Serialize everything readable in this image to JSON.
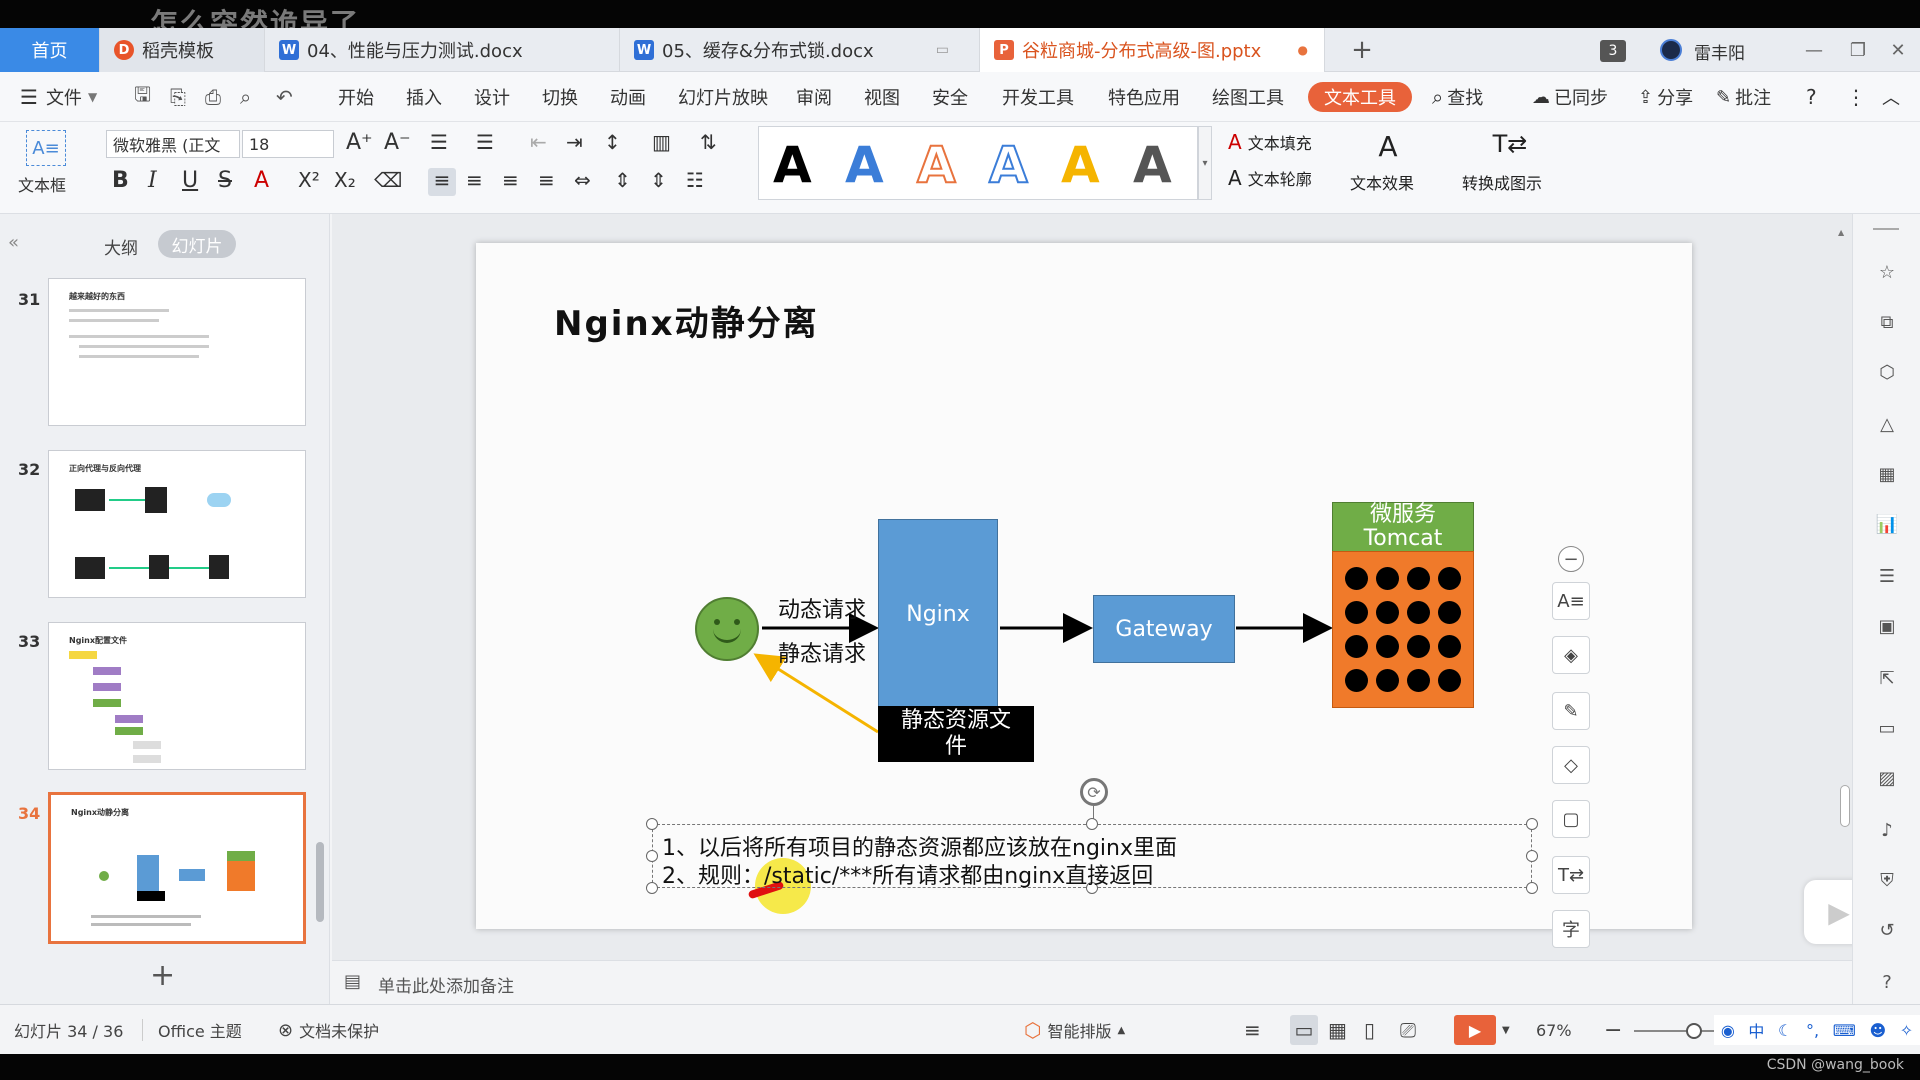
{
  "overlay_title": "怎么突然诡异了",
  "tabs": {
    "home": "首页",
    "t1": "稻壳模板",
    "t2": "04、性能与压力测试.docx",
    "t3": "05、缓存&分布式锁.docx",
    "t4": "谷粒商城-分布式高级-图.pptx",
    "badge": "3",
    "user": "雷丰阳"
  },
  "menu": {
    "file": "文件",
    "items": [
      "开始",
      "插入",
      "设计",
      "切换",
      "动画",
      "幻灯片放映",
      "审阅",
      "视图",
      "安全",
      "开发工具",
      "特色应用",
      "绘图工具"
    ],
    "text_tools": "文本工具",
    "search": "查找",
    "synced": "已同步",
    "share": "分享",
    "comment": "批注"
  },
  "ribbon": {
    "textbox": "文本框",
    "font": "微软雅黑 (正文",
    "size": "18",
    "wordart": [
      "A",
      "A",
      "A",
      "A",
      "A",
      "A"
    ],
    "text_fill": "文本填充",
    "text_outline": "文本轮廓",
    "text_effect": "文本效果",
    "convert": "转换成图示"
  },
  "left_panel": {
    "outline": "大纲",
    "slides": "幻灯片",
    "thumbs": [
      {
        "num": "31",
        "title": "越来越好的东西"
      },
      {
        "num": "32",
        "title": "正向代理与反向代理"
      },
      {
        "num": "33",
        "title": "Nginx配置文件"
      },
      {
        "num": "34",
        "title": "Nginx动静分离"
      }
    ],
    "add": "+"
  },
  "slide": {
    "title": "Nginx动静分离",
    "dynamic_req": "动态请求",
    "static_req": "静态请求",
    "nginx": "Nginx",
    "gateway": "Gateway",
    "static_files": "静态资源文件",
    "tomcat_line1": "微服务",
    "tomcat_line2": "Tomcat",
    "note1": "1、以后将所有项目的静态资源都应该放在nginx里面",
    "note2": "2、规则：/static/***所有请求都由nginx直接返回"
  },
  "notes_placeholder": "单击此处添加备注",
  "status": {
    "slide_count": "幻灯片 34 / 36",
    "theme": "Office 主题",
    "protect": "文档未保护",
    "smart": "智能排版",
    "zoom": "67%"
  },
  "watermark": "CSDN @wang_book"
}
